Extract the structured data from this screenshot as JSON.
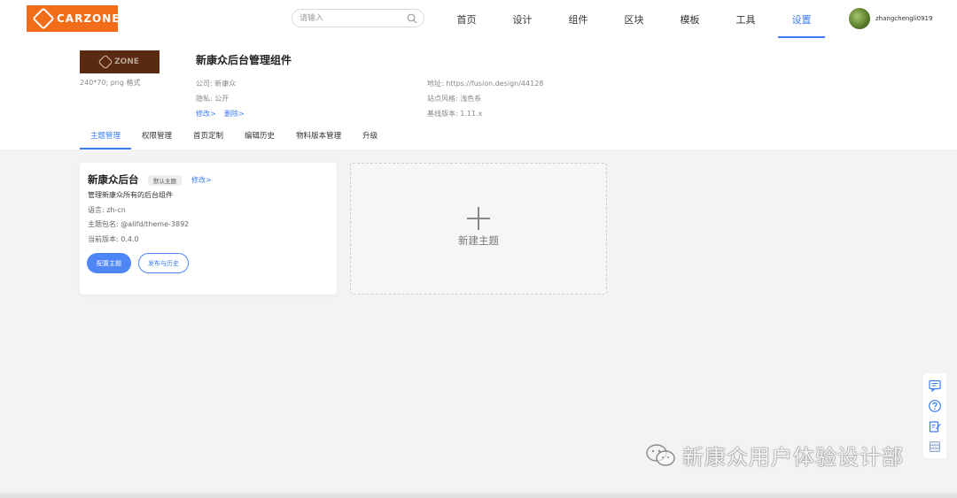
{
  "brand": {
    "logo_text": "CARZONE",
    "accent": "#f26d1a"
  },
  "search": {
    "placeholder": "请输入"
  },
  "nav": {
    "items": [
      "首页",
      "设计",
      "组件",
      "区块",
      "模板",
      "工具",
      "设置"
    ],
    "active": "设置",
    "active_color": "#3b7cf4"
  },
  "user": {
    "name": "zhangchengli0919"
  },
  "project": {
    "thumb_caption": "240*70; png 格式",
    "thumb_logo_text": "ZONE",
    "title": "新康众后台管理组件",
    "company": "公司: 新康众",
    "privacy": "隐私: 公开",
    "edit_link": "修改>",
    "delete_link": "删除>",
    "address": "地址: https://fusion.design/44128",
    "site_style": "站点风格: 浅色系",
    "base_version": "基线版本: 1.11.x"
  },
  "subtabs": [
    "主题管理",
    "权限管理",
    "首页定制",
    "编辑历史",
    "物料版本管理",
    "升级"
  ],
  "theme_card": {
    "title": "新康众后台",
    "badge": "默认主题",
    "edit_link": "修改>",
    "description": "管理新康众所有的后台组件",
    "language": "语言: zh-cn",
    "package": "主题包名: @alifd/theme-3892",
    "version": "当前版本: 0.4.0",
    "configure_button": "配置主题",
    "publish_button": "发布与历史"
  },
  "new_theme": {
    "label": "新建主题"
  },
  "float_toolbar": {
    "icons": [
      "message-icon",
      "help-icon",
      "edit-doc-icon",
      "database-icon"
    ]
  },
  "watermark": {
    "text": "新康众用户体验设计部"
  }
}
